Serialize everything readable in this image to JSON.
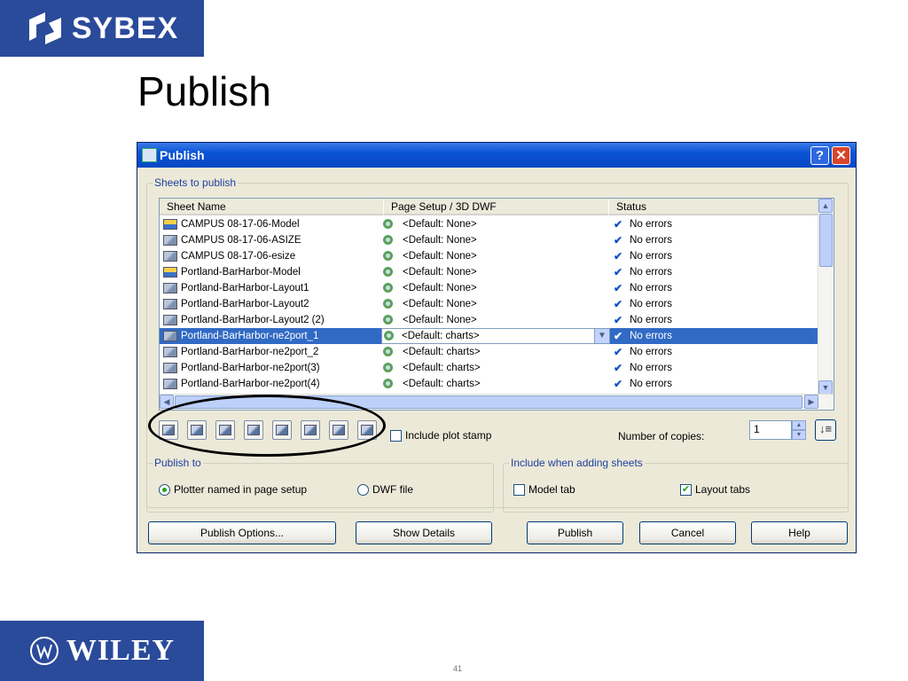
{
  "slide": {
    "title": "Publish",
    "sybex_logo": "SYBEX",
    "wiley_logo": "WILEY",
    "page_number": "41"
  },
  "dialog": {
    "title": "Publish",
    "help_button": "?",
    "close_button": "✕",
    "sheets_group": "Sheets to publish",
    "columns": [
      "Sheet Name",
      "Page Setup / 3D DWF",
      "Status"
    ],
    "rows": [
      {
        "name": "CAMPUS 08-17-06-Model",
        "icon": "model-icon",
        "setup": "<Default: None>",
        "status": "No errors"
      },
      {
        "name": "CAMPUS 08-17-06-ASIZE",
        "icon": "layout-icon",
        "setup": "<Default: None>",
        "status": "No errors"
      },
      {
        "name": "CAMPUS 08-17-06-esize",
        "icon": "layout-icon",
        "setup": "<Default: None>",
        "status": "No errors"
      },
      {
        "name": "Portland-BarHarbor-Model",
        "icon": "model-icon",
        "setup": "<Default: None>",
        "status": "No errors"
      },
      {
        "name": "Portland-BarHarbor-Layout1",
        "icon": "layout-icon",
        "setup": "<Default: None>",
        "status": "No errors"
      },
      {
        "name": "Portland-BarHarbor-Layout2",
        "icon": "layout-icon",
        "setup": "<Default: None>",
        "status": "No errors"
      },
      {
        "name": "Portland-BarHarbor-Layout2 (2)",
        "icon": "layout-icon",
        "setup": "<Default: None>",
        "status": "No errors"
      },
      {
        "name": "Portland-BarHarbor-ne2port_1",
        "icon": "layout-icon",
        "setup": "<Default: charts>",
        "status": "No errors",
        "selected": true
      },
      {
        "name": "Portland-BarHarbor-ne2port_2",
        "icon": "layout-icon",
        "setup": "<Default: charts>",
        "status": "No errors"
      },
      {
        "name": "Portland-BarHarbor-ne2port(3)",
        "icon": "layout-icon",
        "setup": "<Default: charts>",
        "status": "No errors"
      },
      {
        "name": "Portland-BarHarbor-ne2port(4)",
        "icon": "layout-icon",
        "setup": "<Default: charts>",
        "status": "No errors"
      }
    ],
    "toolbar_icons": [
      "preview-icon",
      "add-sheets-icon",
      "remove-sheets-icon",
      "move-up-icon",
      "move-down-icon",
      "load-list-icon",
      "save-list-icon",
      "plot-stamp-settings-icon"
    ],
    "plot_stamp_label": "Include plot stamp",
    "plot_stamp_checked": false,
    "copies_label": "Number of copies:",
    "copies_value": "1",
    "publish_to_group": "Publish to",
    "plotter_option": "Plotter named in page setup",
    "dwf_option": "DWF file",
    "include_group": "Include when adding sheets",
    "model_tab_label": "Model tab",
    "model_tab_checked": false,
    "layout_tabs_label": "Layout tabs",
    "layout_tabs_checked": true,
    "buttons": {
      "publish_options": "Publish Options...",
      "show_details": "Show Details",
      "publish": "Publish",
      "cancel": "Cancel",
      "help": "Help"
    }
  }
}
